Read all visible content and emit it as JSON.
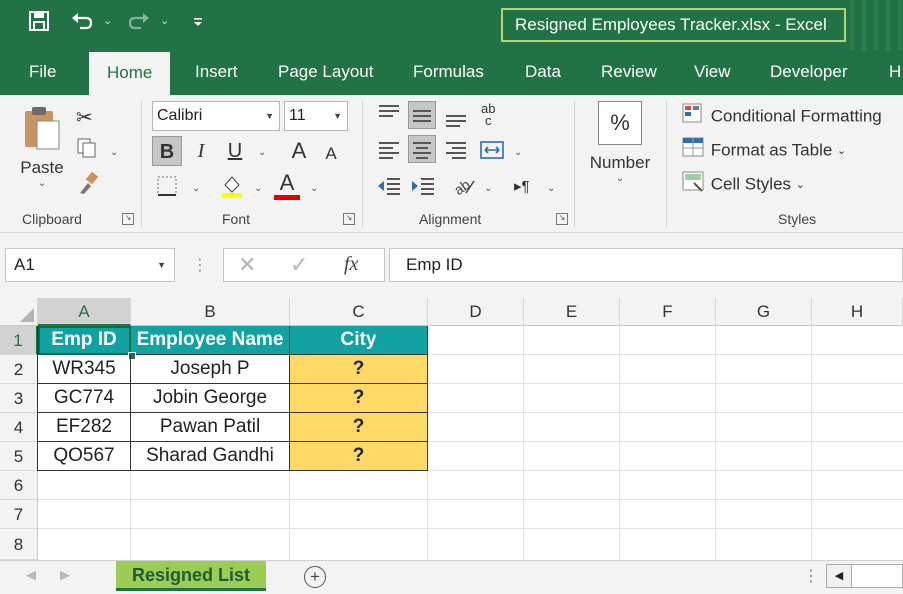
{
  "window": {
    "title": "Resigned Employees Tracker.xlsx  -  Excel",
    "icons": [
      "save-icon",
      "undo-icon",
      "redo-icon",
      "customize-qat-icon"
    ]
  },
  "ribbon": {
    "tabs": [
      "File",
      "Home",
      "Insert",
      "Page Layout",
      "Formulas",
      "Data",
      "Review",
      "View",
      "Developer",
      "H"
    ],
    "active_tab": "Home",
    "clipboard": {
      "paste_label": "Paste",
      "group_label": "Clipboard"
    },
    "font": {
      "name": "Calibri",
      "size": "11",
      "group_label": "Font",
      "bold": "B",
      "italic": "I",
      "underline": "U",
      "grow": "A",
      "shrink": "A",
      "color_letter": "A"
    },
    "alignment": {
      "group_label": "Alignment",
      "wrap_icon_text": "ab\nc"
    },
    "number": {
      "label": "Number",
      "percent": "%"
    },
    "styles": {
      "conditional_formatting": "Conditional Formatting",
      "format_as_table": "Format as Table",
      "cell_styles": "Cell Styles",
      "group_label": "Styles"
    }
  },
  "formula_bar": {
    "name_box": "A1",
    "fx": "fx",
    "value": "Emp ID"
  },
  "grid": {
    "columns": [
      "A",
      "B",
      "C",
      "D",
      "E",
      "F",
      "G",
      "H"
    ],
    "rows": [
      "1",
      "2",
      "3",
      "4",
      "5",
      "6",
      "7",
      "8"
    ],
    "selected_cell": "A1",
    "table": {
      "headers": [
        "Emp ID",
        "Employee Name",
        "City"
      ],
      "rows": [
        [
          "WR345",
          "Joseph P",
          "?"
        ],
        [
          "GC774",
          "Jobin George",
          "?"
        ],
        [
          "EF282",
          "Pawan Patil",
          "?"
        ],
        [
          "QO567",
          "Sharad Gandhi",
          "?"
        ]
      ]
    },
    "colors": {
      "header_fill": "#13a2a2",
      "city_fill": "#ffd966",
      "accent": "#217346"
    }
  },
  "sheets": {
    "active": "Resigned List",
    "add_icon": "+"
  }
}
